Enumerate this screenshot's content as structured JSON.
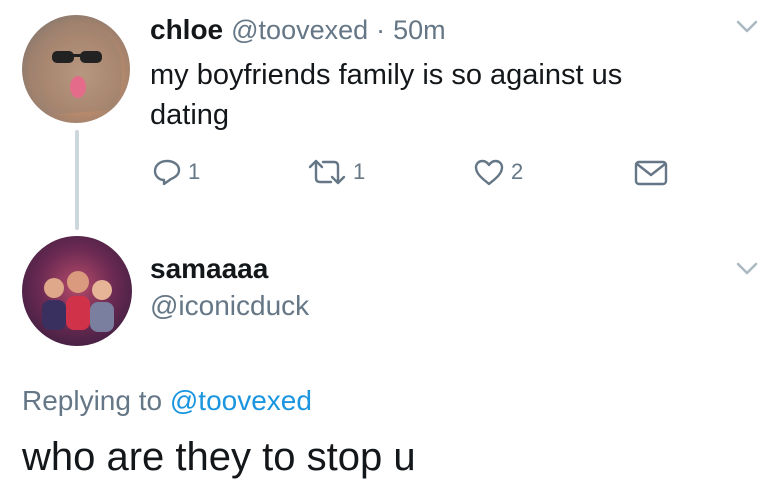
{
  "tweet": {
    "display_name": "chloe",
    "handle": "@toovexed",
    "separator": "·",
    "time": "50m",
    "text_line1": "my boyfriends family is so against us",
    "text_line2": "dating",
    "replies": "1",
    "retweets": "1",
    "likes": "2",
    "icons": {
      "reply": "reply-icon",
      "retweet": "retweet-icon",
      "like": "heart-icon",
      "dm": "envelope-icon",
      "menu": "chevron-down-icon"
    }
  },
  "reply": {
    "display_name": "samaaaa",
    "handle": "@iconicduck",
    "replying_prefix": "Replying to",
    "replying_handle": "@toovexed",
    "text": "who are they to stop u"
  },
  "colors": {
    "text": "#14171a",
    "muted": "#657786",
    "link": "#1b95e0",
    "thread_line": "#ccd6dd"
  }
}
